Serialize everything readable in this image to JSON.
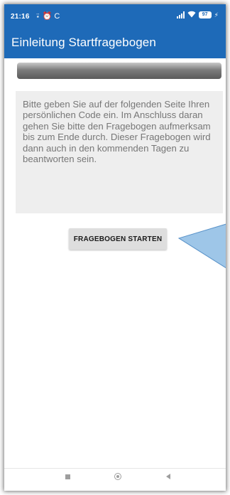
{
  "status_bar": {
    "time": "21:16",
    "left_icons": "⍣ ⏰ C",
    "battery": "97",
    "charging_symbol": "⚡"
  },
  "app_bar": {
    "title": "Einleitung Startfragebogen"
  },
  "progress": {
    "fraction": 0.0
  },
  "info_box": {
    "text": "Bitte geben Sie auf der folgenden Seite Ihren persönlichen Code ein. Im Anschluss daran gehen Sie bitte den Fragebogen aufmerksam bis zum Ende durch. Dieser Fragebogen wird dann auch in den kommenden Tagen zu beantworten sein."
  },
  "start_button": {
    "label": "FRAGEBOGEN STARTEN"
  },
  "nav_bar": {
    "icons": [
      "recent-apps-icon",
      "home-icon",
      "back-icon"
    ]
  },
  "colors": {
    "primary": "#1e6ab8",
    "annotation_arrow": "#9ec6e8"
  }
}
